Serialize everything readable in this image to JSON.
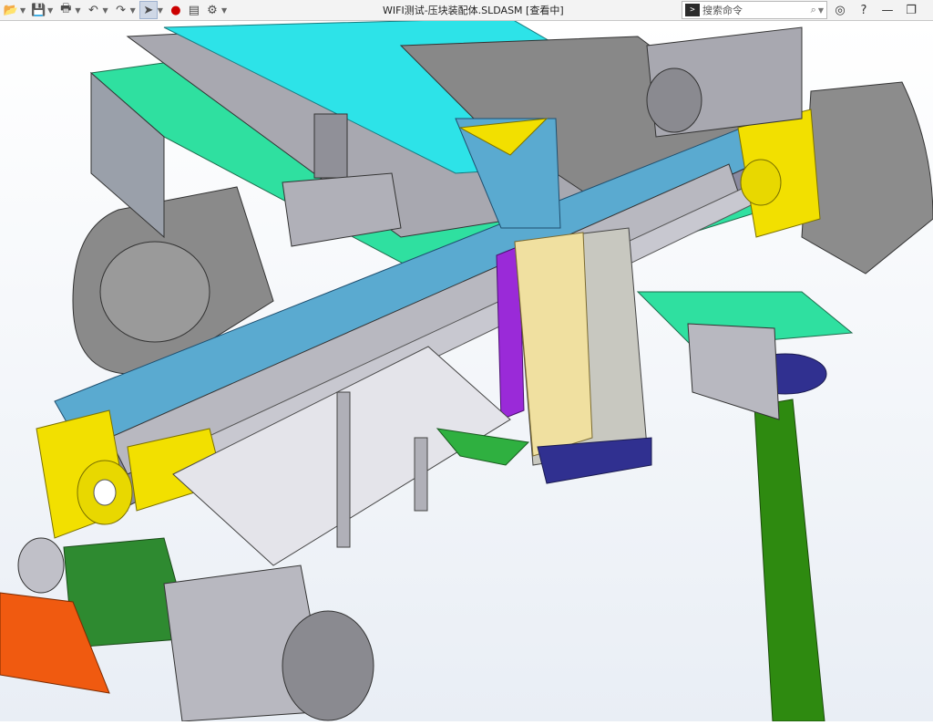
{
  "window": {
    "title": "WIFI测试-压块装配体.SLDASM [查看中]"
  },
  "toolbar": {
    "icons": [
      "open-icon",
      "save-icon",
      "print-icon",
      "undo-icon",
      "redo-icon",
      "select-icon",
      "traffic-light-icon",
      "file-properties-icon",
      "options-gear-icon"
    ]
  },
  "search": {
    "placeholder": "搜索命令"
  },
  "window_controls": [
    "user-icon",
    "help-icon",
    "minimize-icon",
    "restore-icon"
  ],
  "colors": {
    "cyan": "#2de3e8",
    "teal_green": "#2fe0a0",
    "yellow": "#f2e000",
    "purple": "#9a2ad8",
    "green": "#2e8a10",
    "gray": "#b8b8c0",
    "steel_blue": "#5aaad0",
    "orange": "#f05a10",
    "navy": "#303090"
  }
}
